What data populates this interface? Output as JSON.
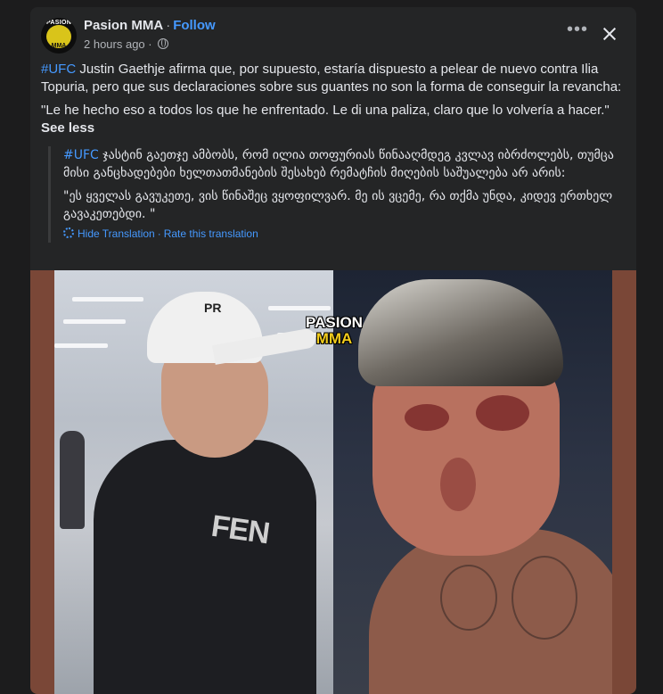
{
  "post": {
    "page_name": "Pasion MMA",
    "separator": "·",
    "follow_label": "Follow",
    "timestamp": "2 hours ago",
    "timestamp_separator": "·",
    "more_icon": "more-horizontal-icon",
    "close_icon": "close-icon",
    "avatar_text_top": "PASION",
    "avatar_text_bottom": "MMA"
  },
  "body": {
    "hashtag": "#UFC",
    "text": " Justin Gaethje afirma que, por supuesto, estaría dispuesto a pelear de nuevo contra Ilia Topuria, pero que sus declaraciones sobre sus guantes no son la forma de conseguir la revancha:",
    "quote": "\"Le he hecho eso a todos los que he enfrentado. Le di una paliza, claro que lo volvería a hacer.\"",
    "see_less_label": "See less"
  },
  "translation": {
    "hashtag": "#UFC",
    "text": " ჯასტინ გაეთჯე ამბობს, რომ ილია თოფურიას წინააღმდეგ კვლავ იბრძოლებს, თუმცა მისი განცხადებები ხელთათმანების შესახებ რემატჩის მიღების საშუალება არ არის:",
    "quote": "\"ეს ყველას გავუკეთე, ვის წინაშეც ვყოფილვარ. მე ის ვცემე, რა თქმა უნდა, კიდევ ერთხელ გავაკეთებდი. \"",
    "hide_label": "Hide Translation",
    "separator": "·",
    "rate_label": "Rate this translation"
  },
  "media": {
    "cap_text": "PR",
    "hoodie_text": "FEN",
    "logo_line1": "PASION",
    "logo_line2": "MMA"
  },
  "colors": {
    "background": "#1c1c1d",
    "card": "#242526",
    "link_blue": "#4599ff",
    "text_primary": "#e4e6eb",
    "text_secondary": "#b0b3b8",
    "media_border": "#7a4737"
  }
}
